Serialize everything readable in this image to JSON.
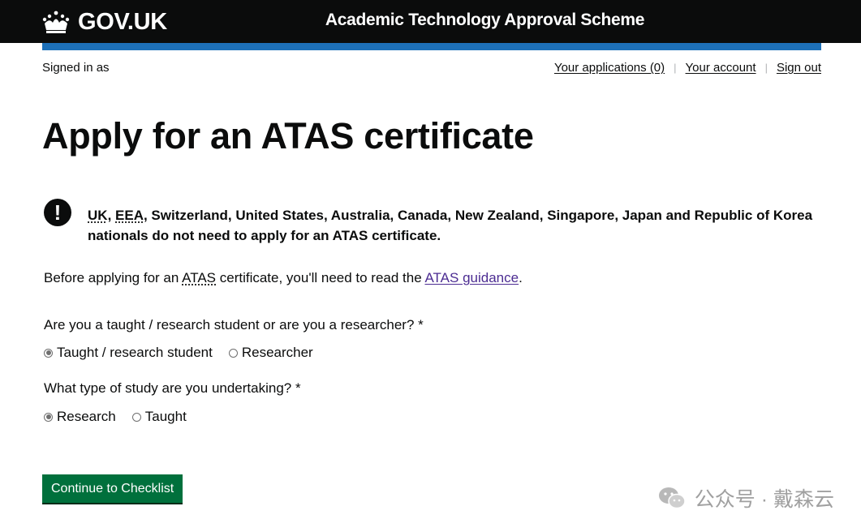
{
  "header": {
    "logo_text": "GOV.UK",
    "service_name": "Academic Technology Approval Scheme"
  },
  "account": {
    "signed_in_label": "Signed in as",
    "nav": [
      {
        "label": "Your applications (0)"
      },
      {
        "label": "Your account"
      },
      {
        "label": "Sign out"
      }
    ]
  },
  "page": {
    "title": "Apply for an ATAS certificate"
  },
  "warning": {
    "icon_text": "!",
    "abbr_uk": "UK",
    "sep1": ", ",
    "abbr_eea": "EEA",
    "rest": ", Switzerland, United States, Australia, Canada, New Zealand, Singapore, Japan and Republic of Korea nationals do not need to apply for an ATAS certificate."
  },
  "intro": {
    "before": "Before applying for an ",
    "abbr": "ATAS",
    "middle": " certificate, you'll need to read the ",
    "link": "ATAS guidance",
    "after": "."
  },
  "questions": [
    {
      "label": "Are you a taught / research student or are you a researcher? *",
      "options": [
        {
          "label": "Taught / research student",
          "checked": true
        },
        {
          "label": "Researcher",
          "checked": false
        }
      ]
    },
    {
      "label": "What type of study are you undertaking? *",
      "options": [
        {
          "label": "Research",
          "checked": true
        },
        {
          "label": "Taught",
          "checked": false
        }
      ]
    }
  ],
  "continue_button": "Continue to Checklist",
  "watermark": {
    "text": "公众号 · 戴森云"
  },
  "colors": {
    "header_bg": "#0b0c0c",
    "blue_bar": "#1d70b8",
    "button_green": "#00703c",
    "visited_link": "#4c2c92"
  }
}
